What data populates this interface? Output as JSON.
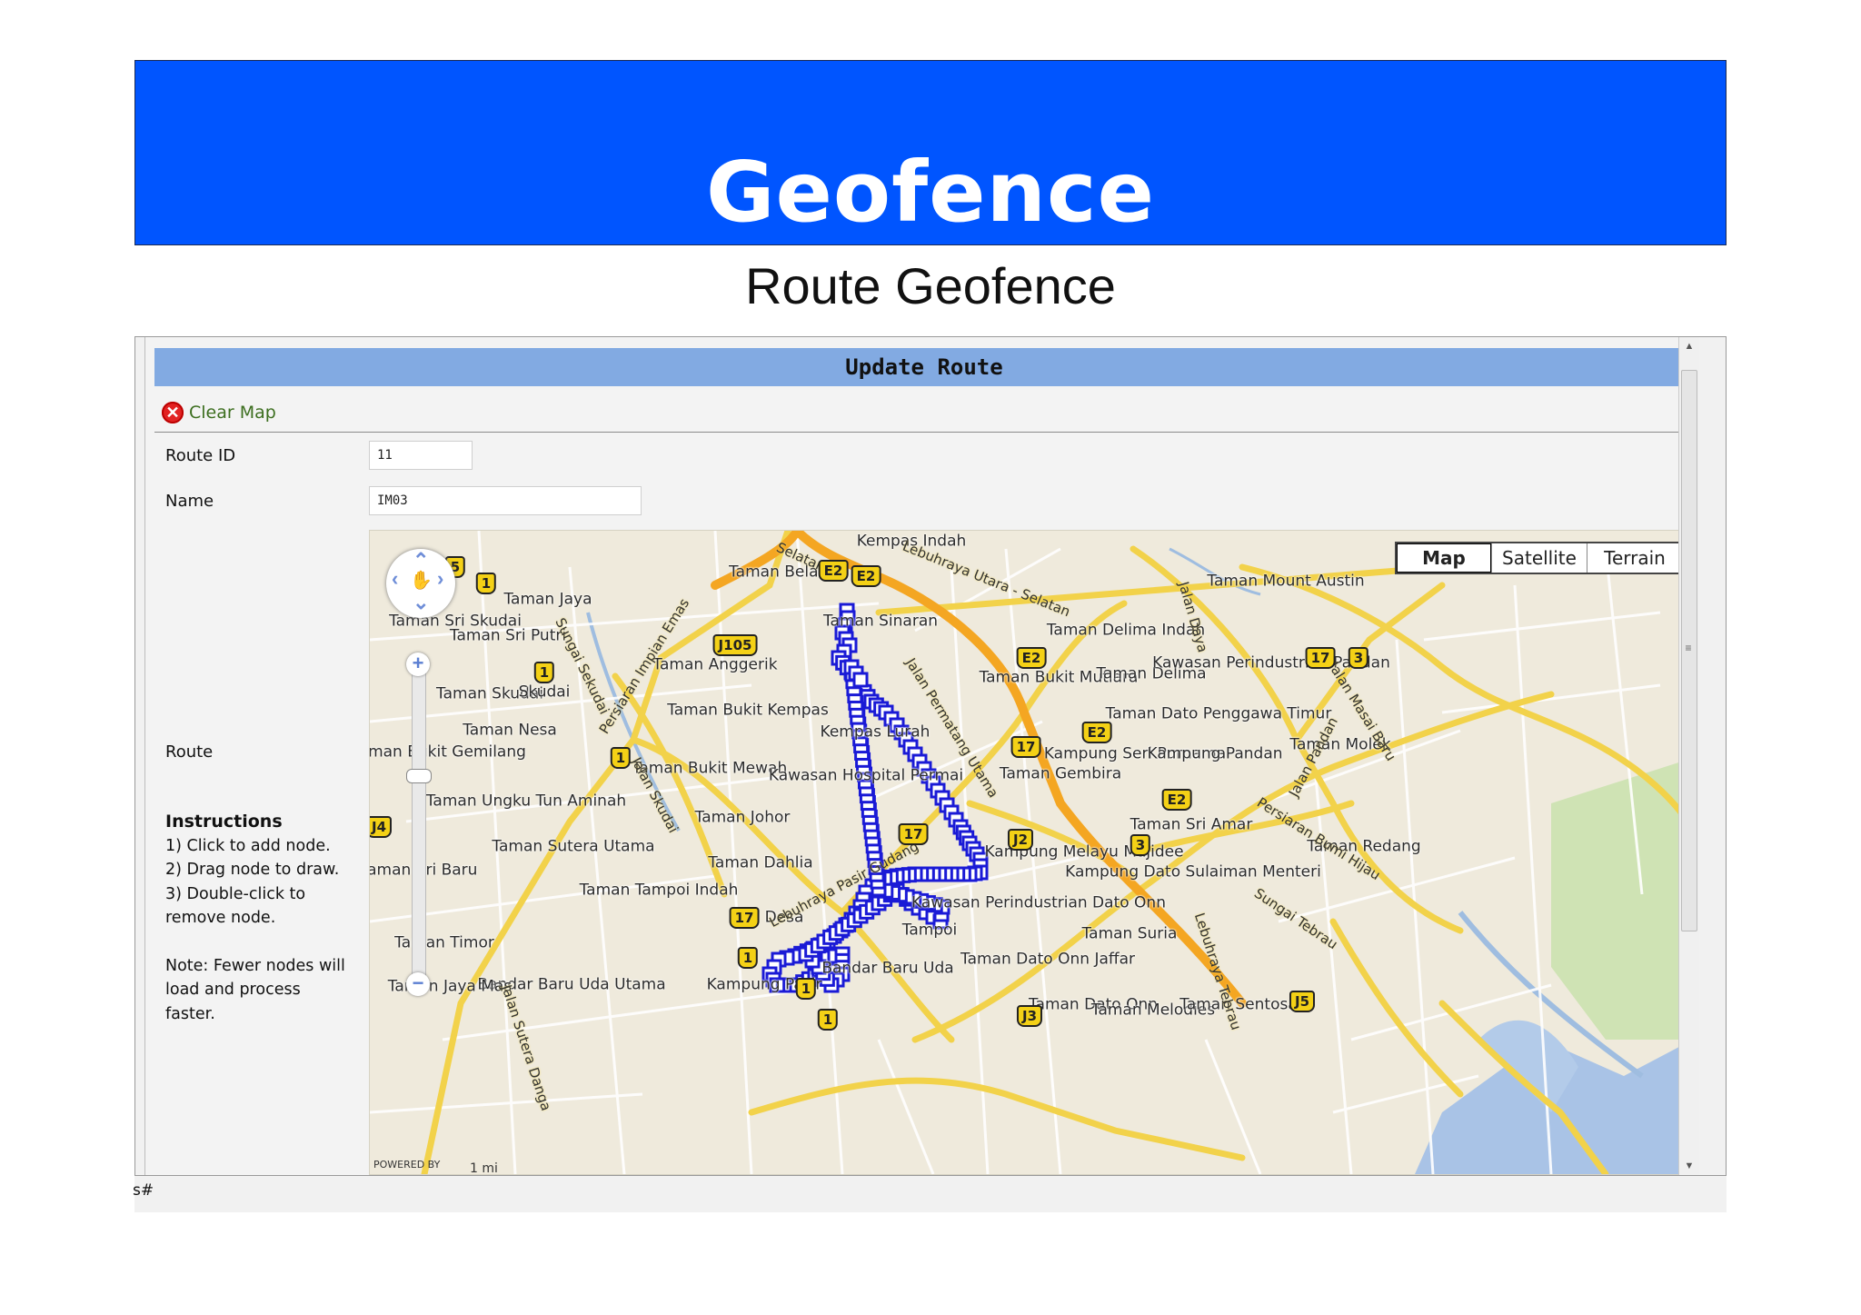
{
  "slide": {
    "title": "Geofence",
    "subtitle": "Route Geofence",
    "header_color": "#0055ff"
  },
  "panel": {
    "header": "Update Route",
    "clear_map_label": "Clear Map",
    "clear_map_icon": "close-circle-icon"
  },
  "form": {
    "route_id_label": "Route ID",
    "route_id_value": "11",
    "name_label": "Name",
    "name_value": "IM03",
    "route_label": "Route"
  },
  "instructions": {
    "heading": "Instructions",
    "steps": [
      "1) Click to add node.",
      "2) Drag node to draw.",
      "3) Double-click to",
      "remove node."
    ],
    "note_lines": [
      "Note: Fewer nodes will",
      "load and process faster."
    ]
  },
  "map": {
    "types": [
      "Map",
      "Satellite",
      "Terrain"
    ],
    "selected_type": "Map",
    "powered_by": "POWERED BY",
    "scale": "1 mi",
    "route_color": "#1a1ad6",
    "places": [
      "Kempas Indah",
      "Taman Belati",
      "Taman Jaya",
      "Taman Sri Skudai",
      "Taman Sri Putri",
      "Taman Skudai",
      "Skudai",
      "Taman Nesa",
      "Taman Anggerik",
      "Taman Bukit Kempas",
      "Taman Bukit Mewah",
      "Kawasan Hospital Permai",
      "Kempas Lurah",
      "Taman Ungku Tun Aminah",
      "Taman Sutera Utama",
      "Taman Johor",
      "Taman Dahlia",
      "Taman Tampoi Indah",
      "Desa",
      "Kampung Pasir",
      "Bandar Baru Uda Utama",
      "Bandar Baru Uda",
      "Taman Jaya Mas",
      "Taman Timor",
      "Taman Sri Baru",
      "Taman Bukit Gemilang",
      "Tampoi",
      "Kawasan Perindustrian Dato Onn",
      "Taman Dato Onn Jaffar",
      "Taman Dato Onn",
      "Taman Melodies",
      "Taman Suria",
      "Kampung Melayu Majidee",
      "Kampung Dato Sulaiman Menteri",
      "Taman Sri Amar",
      "Taman Gembira",
      "Kampung Seri Purnama",
      "Kampung Pandan",
      "Taman Dato Penggawa Timur",
      "Taman Molek",
      "Taman Redang",
      "Taman Sentosa",
      "Taman Bukit Mutiara",
      "Taman Delima",
      "Taman Delima Indah",
      "Kawasan Perindustrian Pandan",
      "Taman Mount Austin",
      "Taman Sinaran"
    ],
    "routes": [
      "Lebuhraya Utara - Selatan",
      "Jalan Permatang Utama",
      "Lebuhraya Pasir Gudang",
      "Jalan Skudai",
      "Sungai Sekudai",
      "Persiaran Impian Emas",
      "Jalan Daya",
      "Jalan Masai Baru",
      "Persiaran Bumi Hijau",
      "Sungai Tebrau",
      "Lebuhraya Tebrau",
      "Jalan Sutera Danga",
      "Jalan Pandan",
      "Selatan"
    ],
    "shields": [
      "5",
      "1",
      "1",
      "1",
      "1",
      "1",
      "1",
      "J105",
      "E2",
      "E2",
      "E2",
      "E2",
      "E2",
      "17",
      "17",
      "17",
      "17",
      "3",
      "3",
      "J2",
      "J3",
      "J4",
      "J5"
    ]
  },
  "status_bar": {
    "text": "s#"
  }
}
